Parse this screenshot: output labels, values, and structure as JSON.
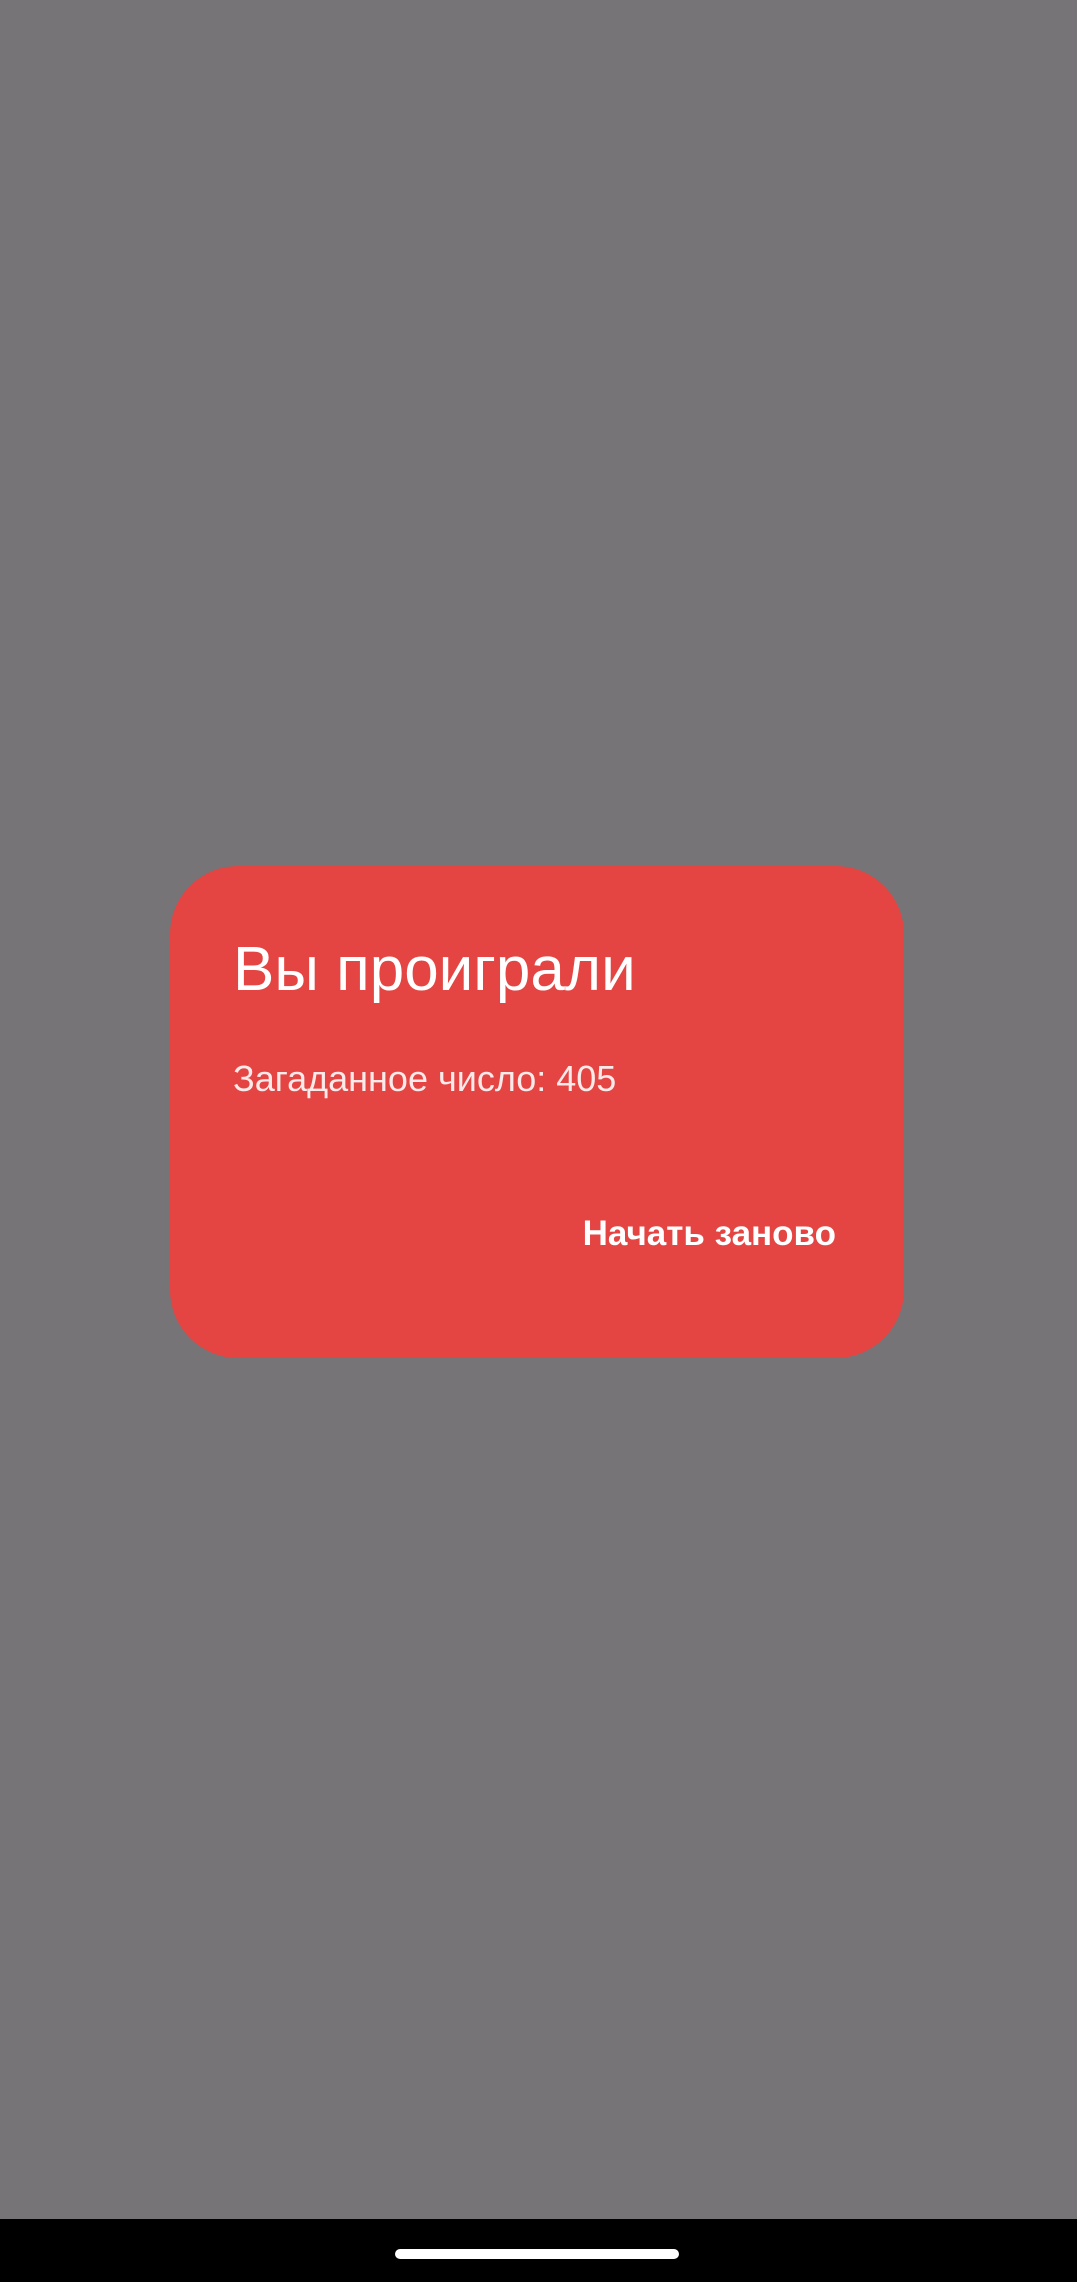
{
  "dialog": {
    "title": "Вы проиграли",
    "message": "Загаданное число: 405",
    "restart_button_label": "Начать заново"
  },
  "colors": {
    "scrim": "#767477",
    "dialog_background": "#e44543",
    "text": "#ffffff",
    "nav_bar": "#000000"
  }
}
